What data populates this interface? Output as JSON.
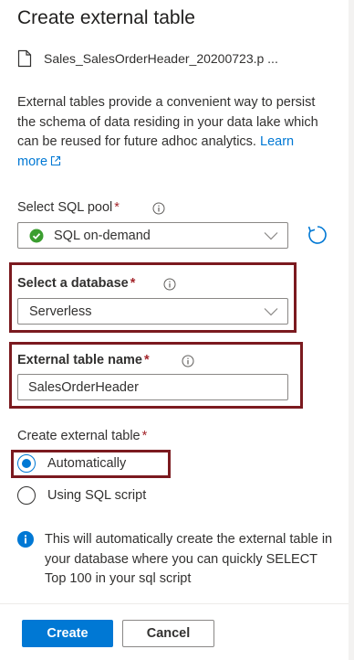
{
  "panel": {
    "title": "Create external table",
    "file_name": "Sales_SalesOrderHeader_20200723.p ...",
    "description": "External tables provide a convenient way to persist the schema of data residing in your data lake which can be reused for future adhoc analytics.",
    "learn_more": "Learn more"
  },
  "sql_pool": {
    "label": "Select SQL pool",
    "required": "*",
    "value": "SQL on-demand",
    "status_color": "#3b9e30"
  },
  "database": {
    "label": "Select a database",
    "required": "*",
    "value": "Serverless"
  },
  "table_name": {
    "label": "External table name",
    "required": "*",
    "value": "SalesOrderHeader"
  },
  "create_method": {
    "label": "Create external table",
    "required": "*",
    "options": [
      "Automatically",
      "Using SQL script"
    ],
    "selected": "Automatically"
  },
  "note": "This will automatically create the external table in your database where you can quickly SELECT Top 100 in your sql script",
  "buttons": {
    "create": "Create",
    "cancel": "Cancel"
  },
  "colors": {
    "accent": "#0078d4",
    "highlight_border": "#7b1a1f",
    "required": "#a4262c"
  }
}
